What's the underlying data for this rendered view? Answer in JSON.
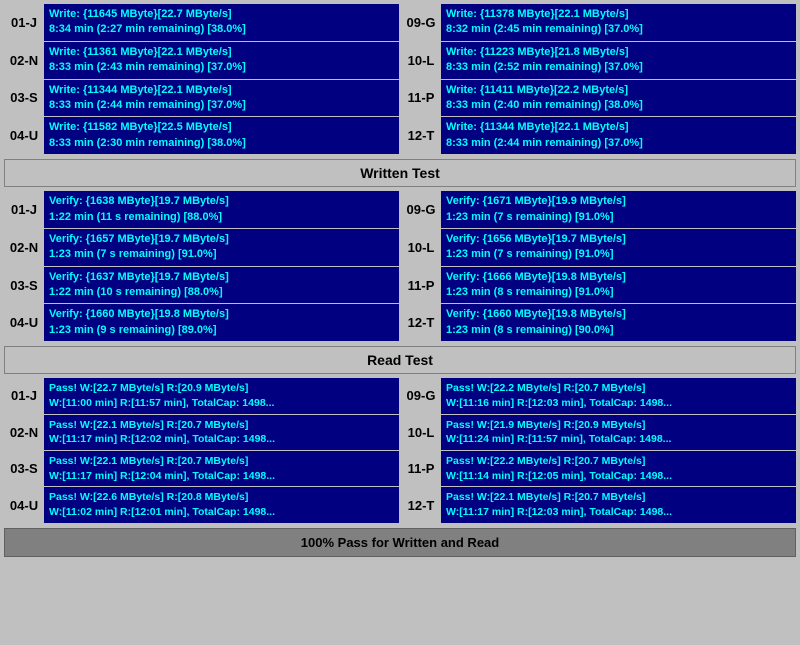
{
  "sections": {
    "write_test": {
      "label": "Written Test",
      "rows_left": [
        {
          "id": "01-J",
          "line1": "Write: {11645 MByte}[22.7 MByte/s]",
          "line2": "8:34 min (2:27 min remaining)  [38.0%]"
        },
        {
          "id": "02-N",
          "line1": "Write: {11361 MByte}[22.1 MByte/s]",
          "line2": "8:33 min (2:43 min remaining)  [37.0%]"
        },
        {
          "id": "03-S",
          "line1": "Write: {11344 MByte}[22.1 MByte/s]",
          "line2": "8:33 min (2:44 min remaining)  [37.0%]"
        },
        {
          "id": "04-U",
          "line1": "Write: {11582 MByte}[22.5 MByte/s]",
          "line2": "8:33 min (2:30 min remaining)  [38.0%]"
        }
      ],
      "rows_right": [
        {
          "id": "09-G",
          "line1": "Write: {11378 MByte}[22.1 MByte/s]",
          "line2": "8:32 min (2:45 min remaining)  [37.0%]"
        },
        {
          "id": "10-L",
          "line1": "Write: {11223 MByte}[21.8 MByte/s]",
          "line2": "8:33 min (2:52 min remaining)  [37.0%]"
        },
        {
          "id": "11-P",
          "line1": "Write: {11411 MByte}[22.2 MByte/s]",
          "line2": "8:33 min (2:40 min remaining)  [38.0%]"
        },
        {
          "id": "12-T",
          "line1": "Write: {11344 MByte}[22.1 MByte/s]",
          "line2": "8:33 min (2:44 min remaining)  [37.0%]"
        }
      ]
    },
    "verify_test": {
      "label": "Written Test",
      "rows_left": [
        {
          "id": "01-J",
          "line1": "Verify: {1638 MByte}[19.7 MByte/s]",
          "line2": "1:22 min (11 s remaining)   [88.0%]"
        },
        {
          "id": "02-N",
          "line1": "Verify: {1657 MByte}[19.7 MByte/s]",
          "line2": "1:23 min (7 s remaining)   [91.0%]"
        },
        {
          "id": "03-S",
          "line1": "Verify: {1637 MByte}[19.7 MByte/s]",
          "line2": "1:22 min (10 s remaining)   [88.0%]"
        },
        {
          "id": "04-U",
          "line1": "Verify: {1660 MByte}[19.8 MByte/s]",
          "line2": "1:23 min (9 s remaining)   [89.0%]"
        }
      ],
      "rows_right": [
        {
          "id": "09-G",
          "line1": "Verify: {1671 MByte}[19.9 MByte/s]",
          "line2": "1:23 min (7 s remaining)   [91.0%]"
        },
        {
          "id": "10-L",
          "line1": "Verify: {1656 MByte}[19.7 MByte/s]",
          "line2": "1:23 min (7 s remaining)   [91.0%]"
        },
        {
          "id": "11-P",
          "line1": "Verify: {1666 MByte}[19.8 MByte/s]",
          "line2": "1:23 min (8 s remaining)   [91.0%]"
        },
        {
          "id": "12-T",
          "line1": "Verify: {1660 MByte}[19.8 MByte/s]",
          "line2": "1:23 min (8 s remaining)   [90.0%]"
        }
      ]
    },
    "read_test": {
      "label": "Read Test",
      "rows_left": [
        {
          "id": "01-J",
          "line1": "Pass! W:[22.7 MByte/s] R:[20.9 MByte/s]",
          "line2": "W:[11:00 min] R:[11:57 min], TotalCap: 1498..."
        },
        {
          "id": "02-N",
          "line1": "Pass! W:[22.1 MByte/s] R:[20.7 MByte/s]",
          "line2": "W:[11:17 min] R:[12:02 min], TotalCap: 1498..."
        },
        {
          "id": "03-S",
          "line1": "Pass! W:[22.1 MByte/s] R:[20.7 MByte/s]",
          "line2": "W:[11:17 min] R:[12:04 min], TotalCap: 1498..."
        },
        {
          "id": "04-U",
          "line1": "Pass! W:[22.6 MByte/s] R:[20.8 MByte/s]",
          "line2": "W:[11:02 min] R:[12:01 min], TotalCap: 1498..."
        }
      ],
      "rows_right": [
        {
          "id": "09-G",
          "line1": "Pass! W:[22.2 MByte/s] R:[20.7 MByte/s]",
          "line2": "W:[11:16 min] R:[12:03 min], TotalCap: 1498..."
        },
        {
          "id": "10-L",
          "line1": "Pass! W:[21.9 MByte/s] R:[20.9 MByte/s]",
          "line2": "W:[11:24 min] R:[11:57 min], TotalCap: 1498..."
        },
        {
          "id": "11-P",
          "line1": "Pass! W:[22.2 MByte/s] R:[20.7 MByte/s]",
          "line2": "W:[11:14 min] R:[12:05 min], TotalCap: 1498..."
        },
        {
          "id": "12-T",
          "line1": "Pass! W:[22.1 MByte/s] R:[20.7 MByte/s]",
          "line2": "W:[11:17 min] R:[12:03 min], TotalCap: 1498..."
        }
      ]
    }
  },
  "headers": {
    "written_test": "Written Test",
    "read_test": "Read Test",
    "footer": "100% Pass for Written and Read"
  }
}
